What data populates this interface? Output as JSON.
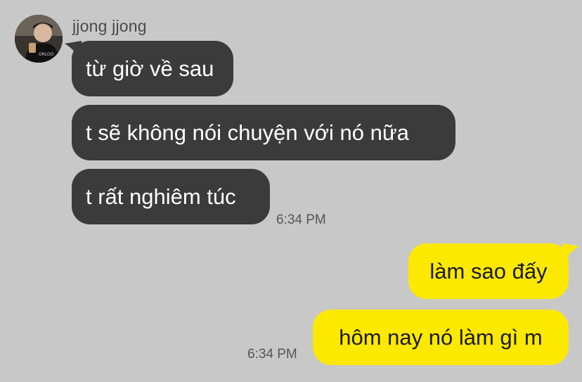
{
  "chat": {
    "sender_name": "jjong jjong",
    "incoming": [
      {
        "text": "từ giờ về sau"
      },
      {
        "text": "t sẽ không nói chuyện với nó nữa"
      },
      {
        "text": "t rất nghiêm túc"
      }
    ],
    "incoming_time": "6:34 PM",
    "outgoing": [
      {
        "text": "làm sao đấy"
      },
      {
        "text": "hôm nay nó làm gì m"
      }
    ],
    "outgoing_time": "6:34 PM"
  },
  "colors": {
    "background": "#c8c8c8",
    "incoming_bubble": "#3b3b3c",
    "outgoing_bubble": "#fde800"
  },
  "icons": {
    "avatar": "profile-photo"
  }
}
